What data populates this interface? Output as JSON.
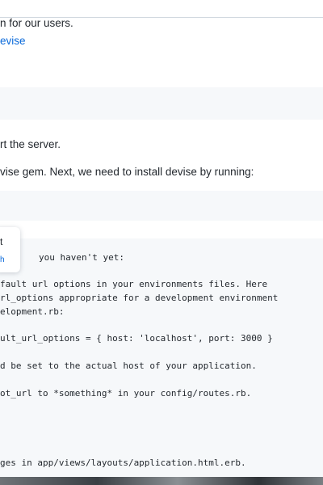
{
  "intro": {
    "line1": "n for our users.",
    "link_text": "evise"
  },
  "steps": {
    "restart_text": "rt the server.",
    "install_text": "vise gem. Next, we need to install devise by running:"
  },
  "tooltip": {
    "title": "t",
    "link": "h"
  },
  "console": {
    "lines": [
      "you haven't yet:",
      "fault url options in your environments files. Here",
      "rl_options appropriate for a development environment",
      "elopment.rb:",
      "ult_url_options = { host: 'localhost', port: 3000 }",
      "d be set to the actual host of your application.",
      "ot_url to *something* in your config/routes.rb.",
      "ges in app/views/layouts/application.html.erb."
    ]
  }
}
